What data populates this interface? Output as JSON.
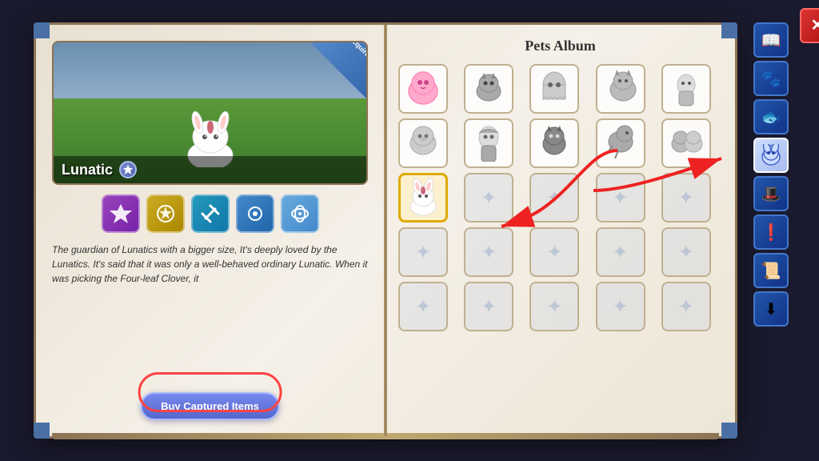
{
  "book": {
    "title": "Pets Album",
    "left_page": {
      "pet_name": "Lunatic",
      "acquired_label": "Acquired",
      "description": "The guardian of Lunatics with a bigger size, It's deeply loved by the Lunatics. It's said that it was only a well-behaved ordinary Lunatic. When it was picking the Four-leaf Clover, it",
      "buy_button_label": "Buy Captured Items",
      "abilities": [
        "✦",
        "✦",
        "✂",
        "☯",
        "✦"
      ]
    },
    "right_page": {
      "rows": 5,
      "cols": 5,
      "pets": [
        {
          "id": 0,
          "has_pet": true,
          "active": true,
          "color_pet": true
        },
        {
          "id": 1,
          "has_pet": true,
          "active": false,
          "color_pet": false
        },
        {
          "id": 2,
          "has_pet": true,
          "active": false,
          "color_pet": false
        },
        {
          "id": 3,
          "has_pet": true,
          "active": false,
          "color_pet": false
        },
        {
          "id": 4,
          "has_pet": true,
          "active": false,
          "color_pet": false
        },
        {
          "id": 5,
          "has_pet": true,
          "active": false,
          "color_pet": false
        },
        {
          "id": 6,
          "has_pet": true,
          "active": false,
          "color_pet": false
        },
        {
          "id": 7,
          "has_pet": true,
          "active": false,
          "color_pet": false
        },
        {
          "id": 8,
          "has_pet": true,
          "active": false,
          "color_pet": false
        },
        {
          "id": 9,
          "has_pet": true,
          "active": false,
          "color_pet": false
        },
        {
          "id": 10,
          "has_pet": true,
          "active": false,
          "selected": true,
          "color_pet": true
        },
        {
          "id": 11,
          "has_pet": false
        },
        {
          "id": 12,
          "has_pet": false
        },
        {
          "id": 13,
          "has_pet": false
        },
        {
          "id": 14,
          "has_pet": false
        },
        {
          "id": 15,
          "has_pet": false
        },
        {
          "id": 16,
          "has_pet": false
        },
        {
          "id": 17,
          "has_pet": false
        },
        {
          "id": 18,
          "has_pet": false
        },
        {
          "id": 19,
          "has_pet": false
        },
        {
          "id": 20,
          "has_pet": false
        },
        {
          "id": 21,
          "has_pet": false
        },
        {
          "id": 22,
          "has_pet": false
        },
        {
          "id": 23,
          "has_pet": false
        },
        {
          "id": 24,
          "has_pet": false
        }
      ]
    },
    "sidebar": {
      "close_label": "✕",
      "buttons": [
        {
          "id": "book",
          "icon": "📖",
          "active": false
        },
        {
          "id": "pets",
          "icon": "🐾",
          "active": false
        },
        {
          "id": "fish",
          "icon": "🐟",
          "active": false
        },
        {
          "id": "pet-face",
          "icon": "🐹",
          "active": true
        },
        {
          "id": "hat",
          "icon": "🎩",
          "active": false
        },
        {
          "id": "alert",
          "icon": "❗",
          "active": false
        },
        {
          "id": "scroll",
          "icon": "📜",
          "active": false
        },
        {
          "id": "arrow-down",
          "icon": "⬇",
          "active": false
        }
      ]
    }
  }
}
